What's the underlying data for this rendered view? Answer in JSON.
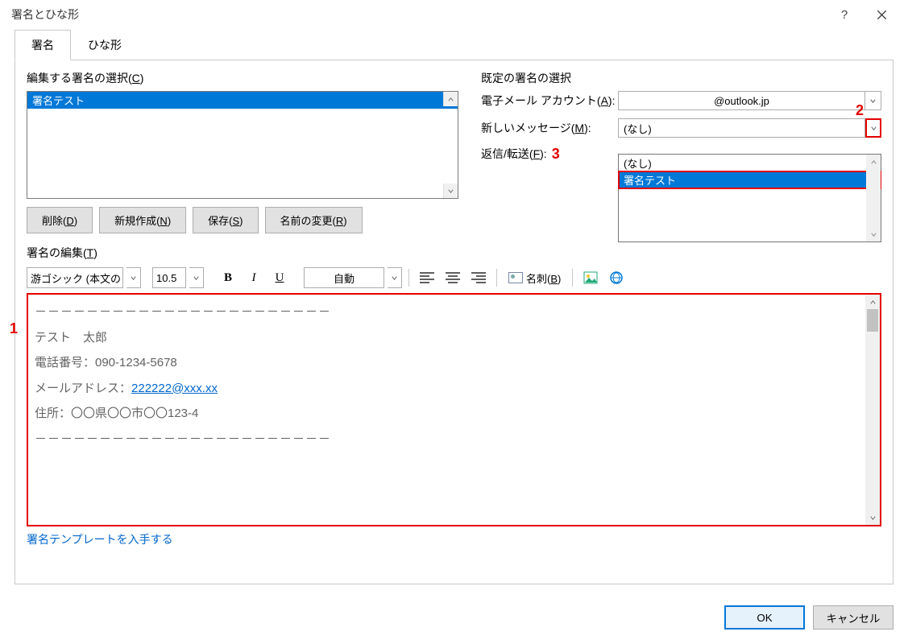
{
  "title": "署名とひな形",
  "tabs": {
    "signature": "署名",
    "template": "ひな形"
  },
  "left": {
    "select_label_pre": "編集する署名の選択(",
    "select_label_u": "C",
    "select_label_post": ")",
    "signatures": [
      "署名テスト"
    ],
    "btn_delete_pre": "削除(",
    "btn_delete_u": "D",
    "btn_delete_post": ")",
    "btn_new_pre": "新規作成(",
    "btn_new_u": "N",
    "btn_new_post": ")",
    "btn_save_pre": "保存(",
    "btn_save_u": "S",
    "btn_save_post": ")",
    "btn_rename_pre": "名前の変更(",
    "btn_rename_u": "R",
    "btn_rename_post": ")"
  },
  "right": {
    "section": "既定の署名の選択",
    "account_label_pre": "電子メール アカウント(",
    "account_label_u": "A",
    "account_label_post": "):",
    "account_value": "@outlook.jp",
    "newmsg_label_pre": "新しいメッセージ(",
    "newmsg_label_u": "M",
    "newmsg_label_post": "):",
    "newmsg_value": "(なし)",
    "reply_label_pre": "返信/転送(",
    "reply_label_u": "F",
    "reply_label_post": "):",
    "dropdown": {
      "opt0": "(なし)",
      "opt1": "署名テスト"
    }
  },
  "edit": {
    "label_pre": "署名の編集(",
    "label_u": "T",
    "label_post": ")",
    "font": "游ゴシック (本文の",
    "size": "10.5",
    "auto": "自動",
    "meishi_pre": "名刺(",
    "meishi_u": "B",
    "meishi_post": ")",
    "body": {
      "sep": "－－－－－－－－－－－－－－－－－－－－－－－",
      "name": "テスト　太郎",
      "phone": "電話番号：090-1234-5678",
      "mail_label": "メールアドレス：",
      "mail_link": "222222@xxx.xx",
      "addr": "住所：〇〇県〇〇市〇〇123-4"
    },
    "template_link": "署名テンプレートを入手する"
  },
  "footer": {
    "ok": "OK",
    "cancel": "キャンセル"
  },
  "annot": {
    "a1": "1",
    "a2": "2",
    "a3": "3"
  }
}
